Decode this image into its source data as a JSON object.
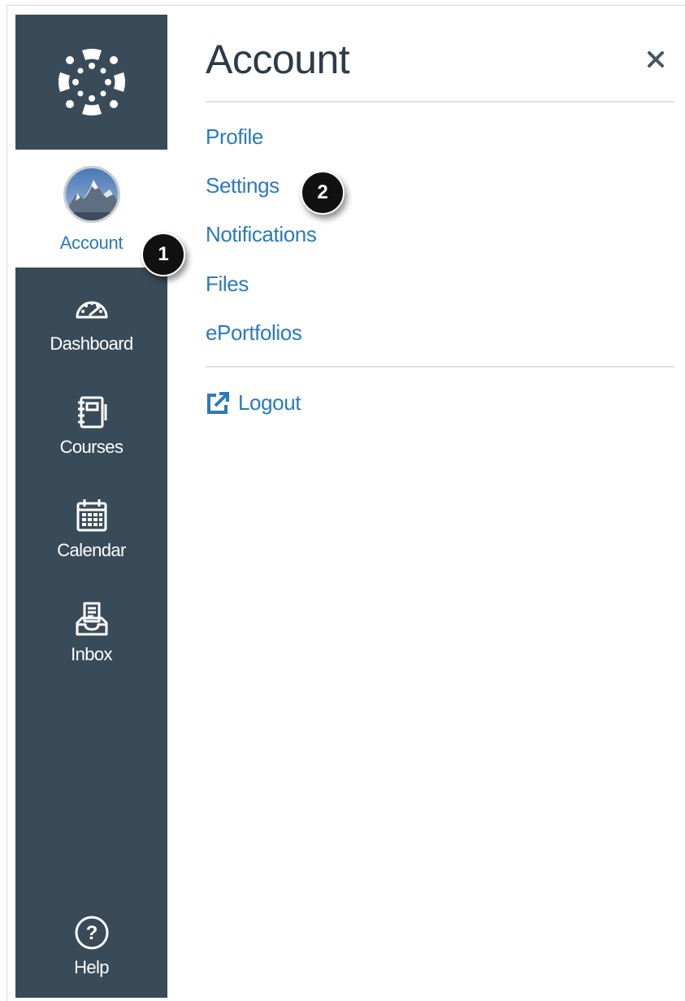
{
  "tray": {
    "title": "Account",
    "links": [
      {
        "id": "profile",
        "label": "Profile"
      },
      {
        "id": "settings",
        "label": "Settings"
      },
      {
        "id": "notifications",
        "label": "Notifications"
      },
      {
        "id": "files",
        "label": "Files"
      },
      {
        "id": "eportfolios",
        "label": "ePortfolios"
      }
    ],
    "logout_label": "Logout",
    "close_icon": "close-icon"
  },
  "nav": {
    "logo_icon": "canvas-logo-icon",
    "account": {
      "label": "Account",
      "icon": "avatar"
    },
    "items": [
      {
        "label": "Dashboard",
        "icon": "dashboard-icon"
      },
      {
        "label": "Courses",
        "icon": "courses-icon"
      },
      {
        "label": "Calendar",
        "icon": "calendar-icon"
      },
      {
        "label": "Inbox",
        "icon": "inbox-icon"
      },
      {
        "label": "Help",
        "icon": "help-icon"
      }
    ]
  },
  "callouts": [
    "1",
    "2"
  ],
  "colors": {
    "nav_bg": "#394b58",
    "link": "#2b7abc",
    "title": "#2d3b45"
  }
}
